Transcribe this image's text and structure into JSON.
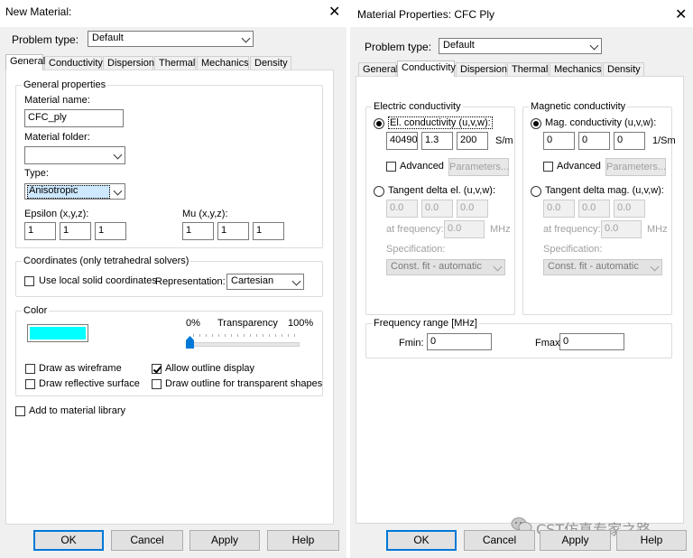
{
  "left": {
    "title": "New Material:",
    "problem_type_label": "Problem type:",
    "problem_type_value": "Default",
    "tabs": [
      "General",
      "Conductivity",
      "Dispersion",
      "Thermal",
      "Mechanics",
      "Density"
    ],
    "general_props": {
      "group_label": "General properties",
      "material_name_label": "Material name:",
      "material_name_value": "CFC_ply",
      "material_folder_label": "Material folder:",
      "material_folder_value": "",
      "type_label": "Type:",
      "type_value": "Anisotropic",
      "epsilon_label": "Epsilon (x,y,z):",
      "epsilon_values": [
        "1",
        "1",
        "1"
      ],
      "mu_label": "Mu (x,y,z):",
      "mu_values": [
        "1",
        "1",
        "1"
      ]
    },
    "coordinates": {
      "group_label": "Coordinates (only tetrahedral solvers)",
      "use_local_label": "Use local solid coordinates",
      "use_local_checked": false,
      "representation_label": "Representation:",
      "representation_value": "Cartesian"
    },
    "color": {
      "group_label": "Color",
      "swatch_color": "#00ffff",
      "transparency_min": "0%",
      "transparency_label": "Transparency",
      "transparency_max": "100%",
      "transparency_value": 0,
      "wireframe_label": "Draw as wireframe",
      "wireframe_checked": false,
      "allow_outline_label": "Allow outline display",
      "allow_outline_checked": true,
      "reflective_label": "Draw reflective surface",
      "reflective_checked": false,
      "outline_transparent_label": "Draw outline for transparent shapes",
      "outline_transparent_checked": false
    },
    "add_library_label": "Add to material library",
    "add_library_checked": false,
    "buttons": {
      "ok": "OK",
      "cancel": "Cancel",
      "apply": "Apply",
      "help": "Help"
    }
  },
  "right": {
    "title": "Material Properties: CFC Ply",
    "problem_type_label": "Problem type:",
    "problem_type_value": "Default",
    "tabs": [
      "General",
      "Conductivity",
      "Dispersion",
      "Thermal",
      "Mechanics",
      "Density"
    ],
    "electric": {
      "group_label": "Electric conductivity",
      "el_cond_label": "El. conductivity (u,v,w):",
      "el_cond_values": [
        "40490",
        "1.3",
        "200"
      ],
      "el_cond_unit": "S/m",
      "advanced_label": "Advanced",
      "parameters_label": "Parameters...",
      "tangent_label": "Tangent delta el. (u,v,w):",
      "tangent_values": [
        "0.0",
        "0.0",
        "0.0"
      ],
      "at_freq_label": "at frequency:",
      "at_freq_value": "0.0",
      "at_freq_unit": "MHz",
      "spec_label": "Specification:",
      "spec_value": "Const. fit - automatic"
    },
    "magnetic": {
      "group_label": "Magnetic conductivity",
      "mag_cond_label": "Mag. conductivity (u,v,w):",
      "mag_cond_values": [
        "0",
        "0",
        "0"
      ],
      "mag_cond_unit": "1/Sm",
      "advanced_label": "Advanced",
      "parameters_label": "Parameters...",
      "tangent_label": "Tangent delta mag. (u,v,w):",
      "tangent_values": [
        "0.0",
        "0.0",
        "0.0"
      ],
      "at_freq_label": "at frequency:",
      "at_freq_value": "0.0",
      "at_freq_unit": "MHz",
      "spec_label": "Specification:",
      "spec_value": "Const. fit - automatic"
    },
    "frequency": {
      "group_label": "Frequency range [MHz]",
      "fmin_label": "Fmin:",
      "fmin_value": "0",
      "fmax_label": "Fmax:",
      "fmax_value": "0"
    },
    "buttons": {
      "ok": "OK",
      "cancel": "Cancel",
      "apply": "Apply",
      "help": "Help"
    },
    "watermark": "CST仿真专家之路"
  }
}
